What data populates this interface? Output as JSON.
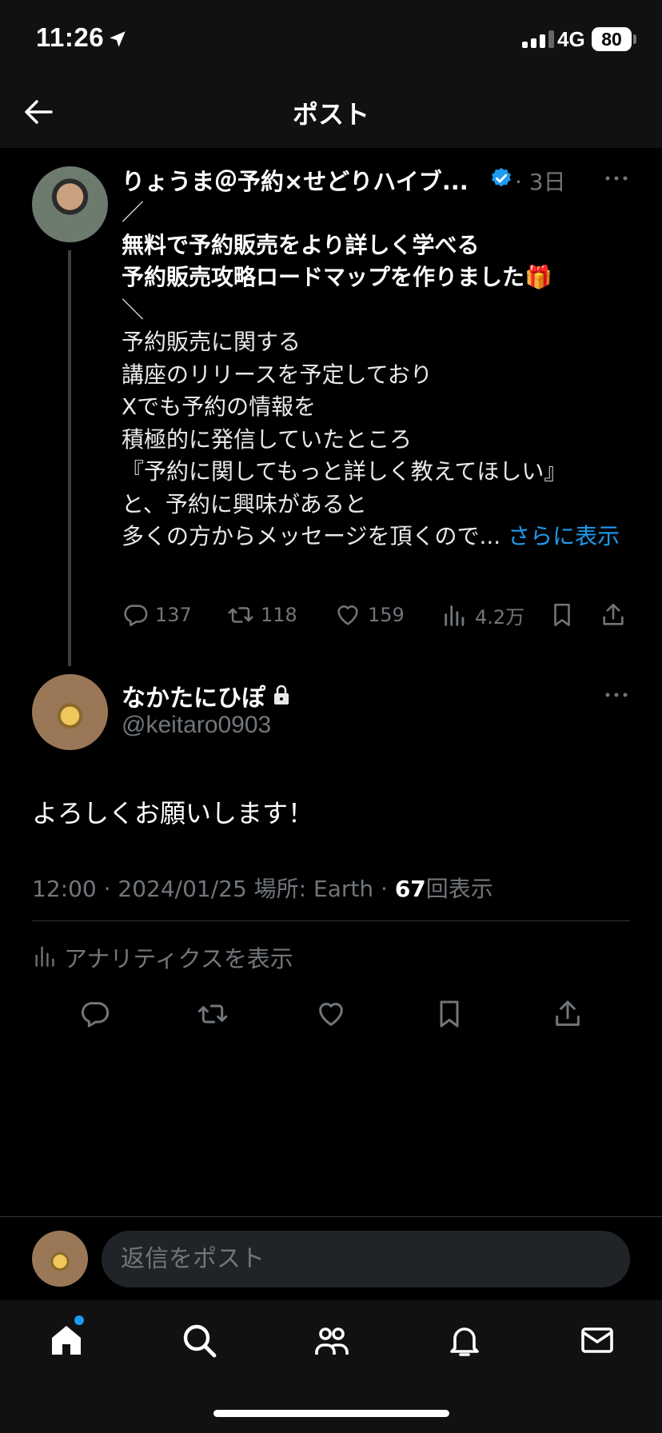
{
  "status_bar": {
    "time": "11:26",
    "network": "4G",
    "battery": "80"
  },
  "header": {
    "title": "ポスト"
  },
  "post": {
    "author_name": "りょうま＠予約×せどりハイブ...",
    "time_ago": "· 3日",
    "lines": [
      {
        "text": "／",
        "bold": false
      },
      {
        "text": "無料で予約販売をより詳しく学べる",
        "bold": true
      },
      {
        "text": "予約販売攻略ロードマップを作りました🎁",
        "bold": true
      },
      {
        "text": "＼",
        "bold": false
      },
      {
        "text": "予約販売に関する",
        "bold": false
      },
      {
        "text": "講座のリリースを予定しており",
        "bold": false
      },
      {
        "text": "Xでも予約の情報を",
        "bold": false
      },
      {
        "text": "積極的に発信していたところ",
        "bold": false
      },
      {
        "text": "『予約に関してもっと詳しく教えてほしい』",
        "bold": false
      },
      {
        "text": "と、予約に興味があると",
        "bold": false
      }
    ],
    "last_line": "多くの方からメッセージを頂くので...",
    "show_more": "さらに表示",
    "stats": {
      "replies": "137",
      "reposts": "118",
      "likes": "159",
      "views": "4.2万"
    }
  },
  "reply": {
    "author_name": "なかたにひぽ",
    "handle": "@keitaro0903",
    "body": "よろしくお願いします！",
    "meta_prefix": "12:00 · 2024/01/25 場所: Earth · ",
    "views_count": "67",
    "views_label": "回表示",
    "analytics_label": "アナリティクスを表示"
  },
  "reply_bar": {
    "placeholder": "返信をポスト"
  },
  "colors": {
    "accent": "#1d9bf0",
    "muted": "#71767b",
    "background": "#000000"
  },
  "icons": [
    "back-arrow-icon",
    "location-arrow-icon",
    "verified-badge-icon",
    "more-icon",
    "reply-icon",
    "repost-icon",
    "like-icon",
    "views-icon",
    "bookmark-icon",
    "share-icon",
    "lock-icon",
    "home-icon",
    "search-icon",
    "communities-icon",
    "notifications-icon",
    "messages-icon"
  ]
}
